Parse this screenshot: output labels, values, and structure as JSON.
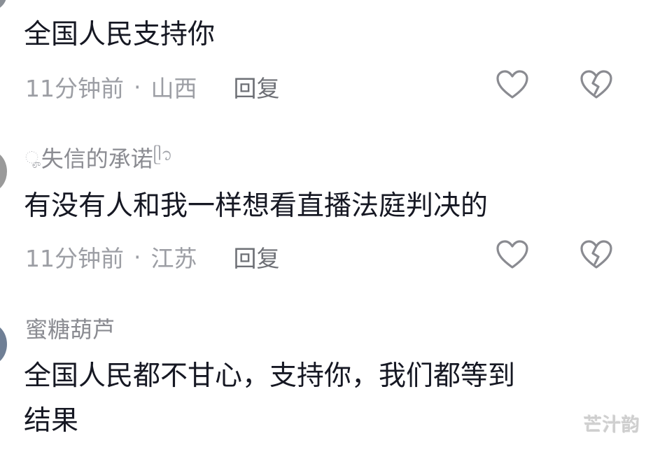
{
  "comments": [
    {
      "username": "",
      "text": "全国人民支持你",
      "time": "11分钟前",
      "location": "山西",
      "reply_label": "回复"
    },
    {
      "username": "失信的承诺",
      "username_prefix": "ೄ",
      "username_suffix": "ᥫ᭡",
      "text": "有没有人和我一样想看直播法庭判决的",
      "time": "11分钟前",
      "location": "江苏",
      "reply_label": "回复"
    },
    {
      "username": "蜜糖葫芦",
      "text_line1": "全国人民都不甘心，支持你，我们都等到",
      "text_line2": "结果"
    }
  ],
  "separator": "·",
  "icons": {
    "like": "heart-outline-icon",
    "dislike": "broken-heart-icon"
  },
  "watermark": "芒汁韵",
  "colors": {
    "text": "#161823",
    "meta": "#9c9ea4",
    "icon": "#8a8b91"
  }
}
